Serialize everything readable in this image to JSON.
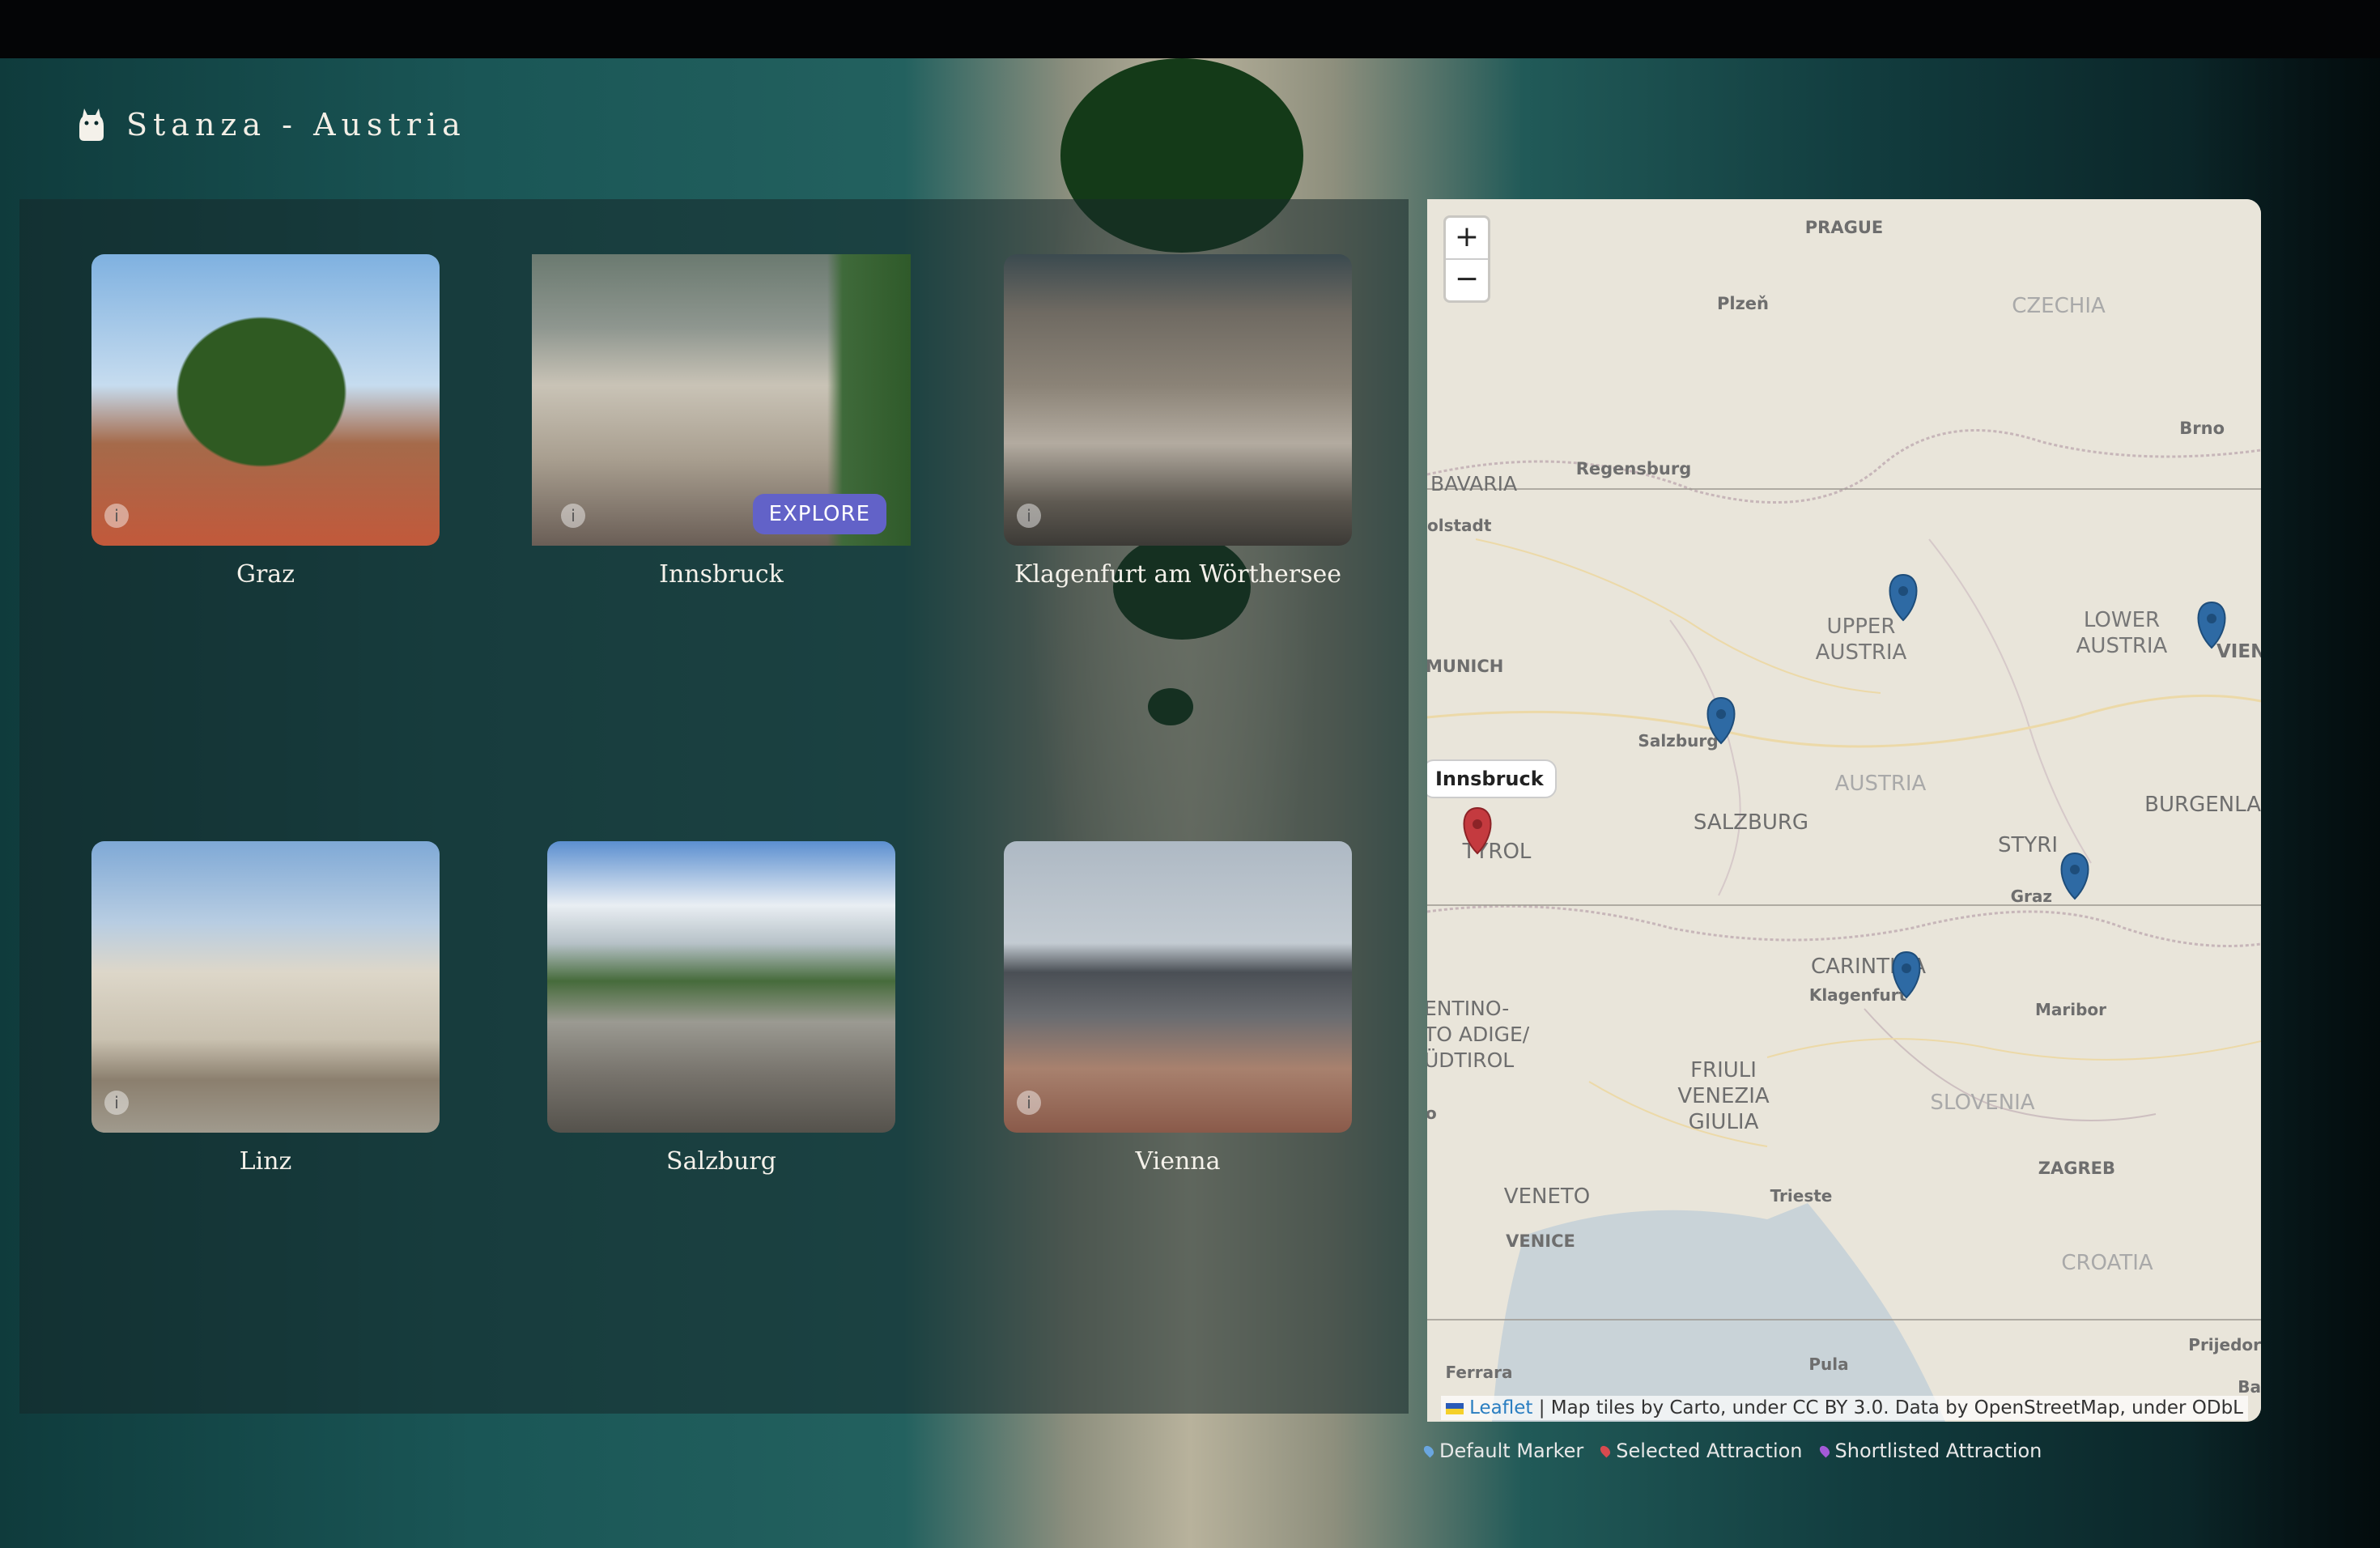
{
  "app": {
    "title": "Stanza - Austria"
  },
  "cities": [
    {
      "name": "Graz"
    },
    {
      "name": "Innsbruck",
      "action_label": "EXPLORE"
    },
    {
      "name": "Klagenfurt am Wörthersee"
    },
    {
      "name": "Linz"
    },
    {
      "name": "Salzburg"
    },
    {
      "name": "Vienna"
    }
  ],
  "map": {
    "zoom_in": "+",
    "zoom_out": "−",
    "tooltip": "Innsbruck",
    "place_labels": {
      "prague": "PRAGUE",
      "plzen": "Plzeň",
      "czechia": "CZECHIA",
      "brno": "Brno",
      "regensburg": "Regensburg",
      "bavaria": "BAVARIA",
      "olstadt": "olstadt",
      "upper_austria": [
        "UPPER",
        "AUSTRIA"
      ],
      "lower_austria": [
        "LOWER",
        "AUSTRIA"
      ],
      "vien": "VIEN",
      "munich": "MUNICH",
      "salzburg_city": "Salzburg",
      "austria": "AUSTRIA",
      "burgenla": "BURGENLA",
      "salzburg_state": "SALZBURG",
      "tyrol": "TYROL",
      "styria": "STYRI",
      "graz": "Graz",
      "carinthia": "CARINTHIA",
      "klagenfurt": "Klagenfurt",
      "maribor": "Maribor",
      "trentino": [
        "ENTINO-",
        "TO ADIGE/",
        "ÜDTIROL"
      ],
      "friuli": [
        "FRIULI",
        "VENEZIA",
        "GIULIA"
      ],
      "slovenia": "SLOVENIA",
      "zagreb": "ZAGREB",
      "veneto": "VENETO",
      "trieste": "Trieste",
      "venice": "VENICE",
      "croatia": "CROATIA",
      "pula": "Pula",
      "ferrara": "Ferrara",
      "prijedor": "Prijedor",
      "ba": "Ba",
      "o": "o"
    },
    "attribution": {
      "leaflet": "Leaflet",
      "text": "| Map tiles by Carto, under CC BY 3.0. Data by OpenStreetMap, under ODbL"
    },
    "marker_colors": {
      "default": "#2e6aa4",
      "selected": "#c43a3f",
      "shortlisted": "#8a3fc4"
    }
  },
  "legend": {
    "default": "Default Marker",
    "selected": "Selected Attraction",
    "shortlisted": "Shortlisted Attraction"
  }
}
